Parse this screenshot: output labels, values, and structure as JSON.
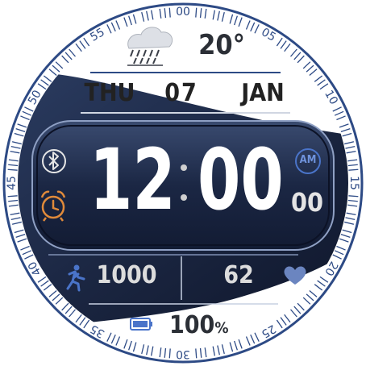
{
  "bezel": {
    "labels": [
      "00",
      "05",
      "10",
      "15",
      "20",
      "25",
      "30",
      "35",
      "40",
      "45",
      "50",
      "55"
    ]
  },
  "weather": {
    "icon": "rain-cloud-icon",
    "temperature": "20°"
  },
  "date": {
    "weekday": "THU",
    "day": "07",
    "month": "JAN"
  },
  "time": {
    "hours": "12",
    "minutes": "00",
    "seconds": "00",
    "ampm": "AM",
    "colon": ":"
  },
  "status": {
    "bluetooth_icon": "bluetooth-icon",
    "alarm_icon": "alarm-clock-icon"
  },
  "stats": {
    "steps_icon": "running-person-icon",
    "steps": "1000",
    "heart_rate": "62",
    "heart_icon": "heart-icon"
  },
  "battery": {
    "icon": "battery-icon",
    "percent": "100",
    "unit": "%"
  },
  "colors": {
    "bezel_blue": "#2d4a85",
    "navy": "#1e2b48",
    "alarm_orange": "#e08a3a",
    "text_gray": "#e2e2e2"
  }
}
